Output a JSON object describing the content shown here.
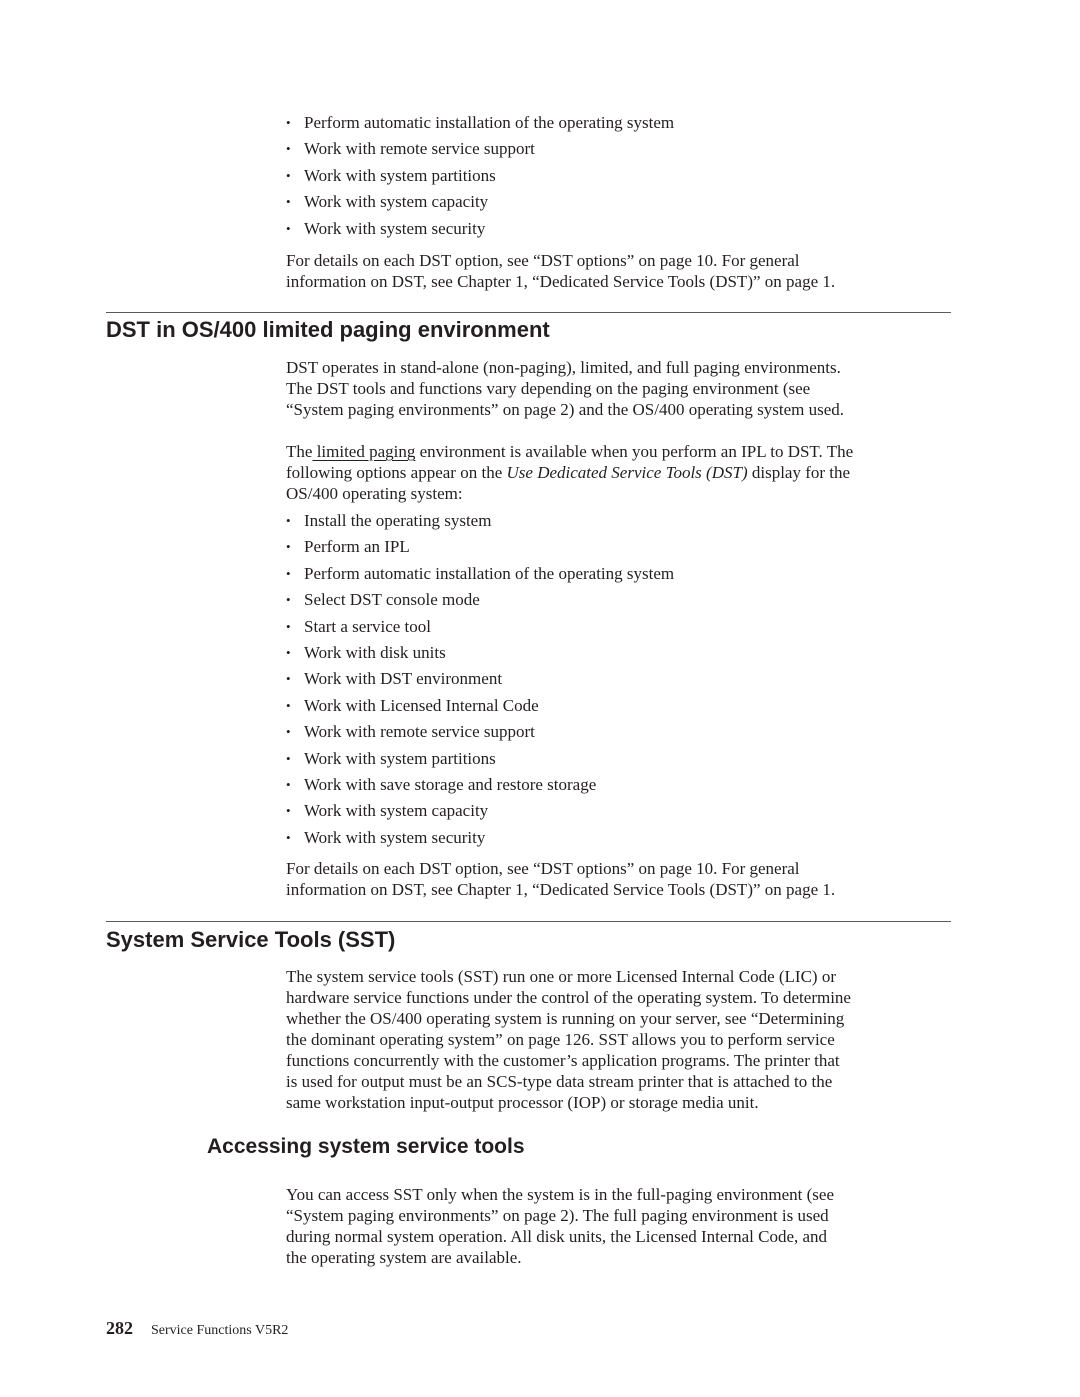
{
  "top_section": {
    "bullets": [
      "Perform automatic installation of the operating system",
      "Work with remote service support",
      "Work with system partitions",
      "Work with system capacity",
      "Work with system security"
    ],
    "details_line1": "For details on each DST option, see “DST options” on page 10. For general",
    "details_line2": "information on DST, see Chapter 1, “Dedicated Service Tools (DST)” on page 1."
  },
  "limited_paging_section": {
    "heading": "DST in OS/400 limited paging environment",
    "intro_lines": [
      "DST operates in stand-alone (non-paging), limited, and full paging environments.",
      "The DST tools and functions vary depending on the paging environment (see",
      "“System paging environments” on page 2) and the OS/400 operating system used."
    ],
    "para2_prefix": "The",
    "para2_link": " limited paging",
    "para2_after_link": " environment is available when you perform an IPL to DST. The",
    "para2_line2_prefix": "following options appear on the ",
    "para2_line2_italic": "Use Dedicated Service Tools (DST)",
    "para2_line2_suffix": " display for the",
    "para2_line3": "OS/400 operating system:",
    "bullets": [
      "Install the operating system",
      "Perform an IPL",
      "Perform automatic installation of the operating system",
      "Select DST console mode",
      "Start a service tool",
      "Work with disk units",
      "Work with DST environment",
      "Work with Licensed Internal Code",
      "Work with remote service support",
      "Work with system partitions",
      "Work with save storage and restore storage",
      "Work with system capacity",
      "Work with system security"
    ],
    "details_line1": "For details on each DST option, see “DST options” on page 10. For general",
    "details_line2": "information on DST, see Chapter 1, “Dedicated Service Tools (DST)” on page 1."
  },
  "sst_section": {
    "heading": "System Service Tools (SST)",
    "lines": [
      "The system service tools (SST) run one or more Licensed Internal Code (LIC) or",
      "hardware service functions under the control of the operating system. To determine",
      "whether the OS/400 operating system is running on your server, see “Determining",
      "the dominant operating system” on page 126. SST allows you to perform service",
      "functions concurrently with the customer’s application programs. The printer that",
      "is used for output must be an SCS-type data stream printer that is attached to the",
      "same workstation input-output processor (IOP) or storage media unit."
    ]
  },
  "accessing_section": {
    "heading": "Accessing system service tools",
    "lines": [
      "You can access SST only when the system is in the full-paging environment (see",
      "“System paging environments” on page 2). The full paging environment is used",
      "during normal system operation. All disk units, the Licensed Internal Code, and",
      "the operating system are available."
    ]
  },
  "footer": {
    "page_number": "282",
    "book_title": "Service Functions V5R2"
  },
  "bullet_glyph": "•"
}
